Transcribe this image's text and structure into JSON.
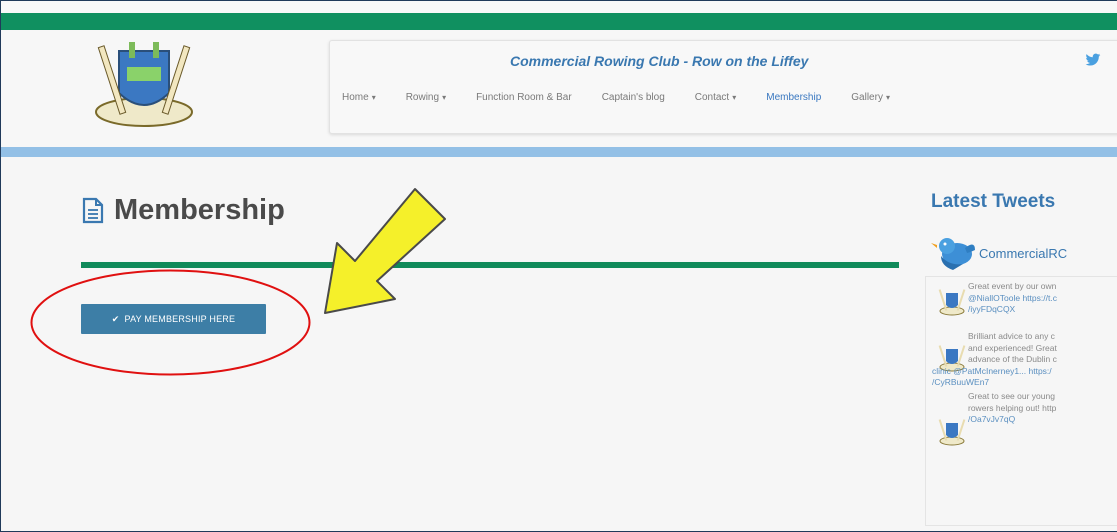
{
  "site": {
    "club_title": "Commercial Rowing Club - Row on the Liffey",
    "social": "twitter-icon"
  },
  "nav": {
    "items": [
      {
        "label": "Home",
        "caret": true
      },
      {
        "label": "Rowing",
        "caret": true
      },
      {
        "label": "Function Room & Bar",
        "caret": false
      },
      {
        "label": "Captain's blog",
        "caret": false
      },
      {
        "label": "Contact",
        "caret": true
      },
      {
        "label": "Membership",
        "caret": false,
        "active": true
      },
      {
        "label": "Gallery",
        "caret": true
      }
    ]
  },
  "page": {
    "title": "Membership",
    "pay_button_label": "PAY MEMBERSHIP HERE",
    "pay_button_icon": "check-icon"
  },
  "sidebar": {
    "title": "Latest Tweets",
    "handle": "CommercialRC",
    "tweets": [
      {
        "lines": [
          "Great event by our own",
          "@NiallOToole https://t.c",
          "/iyyFDqCQX"
        ]
      },
      {
        "lines": [
          "Brilliant advice to any c",
          "and experienced! Great",
          "advance of the Dublin c",
          "clinic @PatMcInerney1... https:/",
          "/CyRBuuWEn7"
        ]
      },
      {
        "lines": [
          "Great to see our young",
          "rowers helping out! http",
          "/Oa7vJv7qQ"
        ]
      }
    ]
  },
  "colors": {
    "green": "#109060",
    "blue_bar": "#93c0e6",
    "button": "#3d7ea6",
    "annotation_red": "#e01010",
    "annotation_arrow": "#f5f02a"
  }
}
